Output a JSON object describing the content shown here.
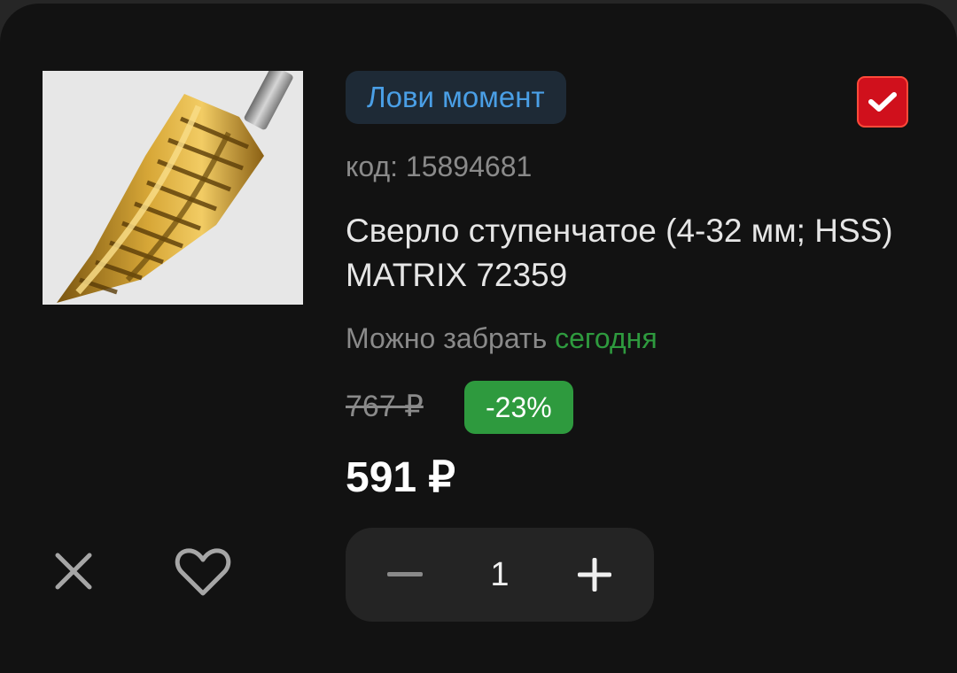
{
  "product": {
    "promo_badge": "Лови момент",
    "code": "код: 15894681",
    "title": "Сверло ступенчатое (4-32 мм; HSS) MATRIX 72359",
    "pickup_label": "Можно забрать",
    "pickup_when": "сегодня",
    "old_price": "767 ₽",
    "discount": "-23%",
    "price": "591 ₽",
    "selected": true,
    "image_icon": "step-drill-bit"
  },
  "actions": {
    "remove_icon": "close-icon",
    "favorite_icon": "heart-outline-icon"
  },
  "quantity": {
    "value": "1",
    "decrement_icon": "minus-icon",
    "increment_icon": "plus-icon"
  },
  "colors": {
    "background": "#121212",
    "promo_text": "#4a9fe6",
    "promo_bg": "#1e2a36",
    "checkbox": "#d0101c",
    "discount_bg": "#2e9a3e",
    "pickup_today": "#2e9a3e",
    "muted_text": "#8a8a8a"
  }
}
